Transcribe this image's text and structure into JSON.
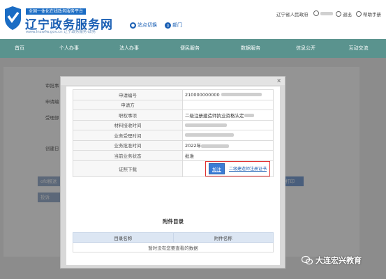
{
  "header": {
    "tagline": "全国一体化在线政务服务平台",
    "site_title": "辽宁政务服务网",
    "site_url": "www.lnzwfw.gov.cn 辽宁政务服务·政务",
    "links": [
      {
        "label": "站点切换",
        "icon": "location-pin-icon"
      },
      {
        "label": "部门",
        "icon": "department-icon"
      }
    ],
    "utility": {
      "gov_name": "辽宁省人民政府",
      "user_icon": "user-icon",
      "logout_label": "退出",
      "help_label": "帮助手册"
    }
  },
  "nav": {
    "items": [
      "首页",
      "个人办事",
      "法人办事",
      "便民服务",
      "数据服务",
      "信息公开",
      "互动交流"
    ]
  },
  "background_page": {
    "labels": [
      "审批事",
      "申请编",
      "受理部",
      "创建日"
    ],
    "buttons": [
      "ofd报送",
      "投诉",
      "打印"
    ]
  },
  "modal": {
    "close_label": "×",
    "rows": [
      {
        "key": "申请编号",
        "value": "210000000000"
      },
      {
        "key": "申请方",
        "value": ""
      },
      {
        "key": "职权事项",
        "value": "二级注册建造师执业资格认定"
      },
      {
        "key": "材料接收时间",
        "value": ""
      },
      {
        "key": "业务受理时间",
        "value": ""
      },
      {
        "key": "业务批准时间",
        "value": "2022年"
      },
      {
        "key": "当前业务状态",
        "value": "批准"
      }
    ],
    "download": {
      "key": "证照下载",
      "add_button": "加注",
      "cert_link": "二级建造师注册证书"
    },
    "attachments": {
      "title": "附件目录",
      "columns": [
        "目录名称",
        "附件名称"
      ],
      "empty_text": "暂时没有您要查看的数据"
    }
  },
  "watermark": {
    "text": "大连宏兴教育"
  },
  "colors": {
    "nav_bg": "#5a938e",
    "brand_blue": "#1a5fb4",
    "highlight_red": "#e03131"
  }
}
